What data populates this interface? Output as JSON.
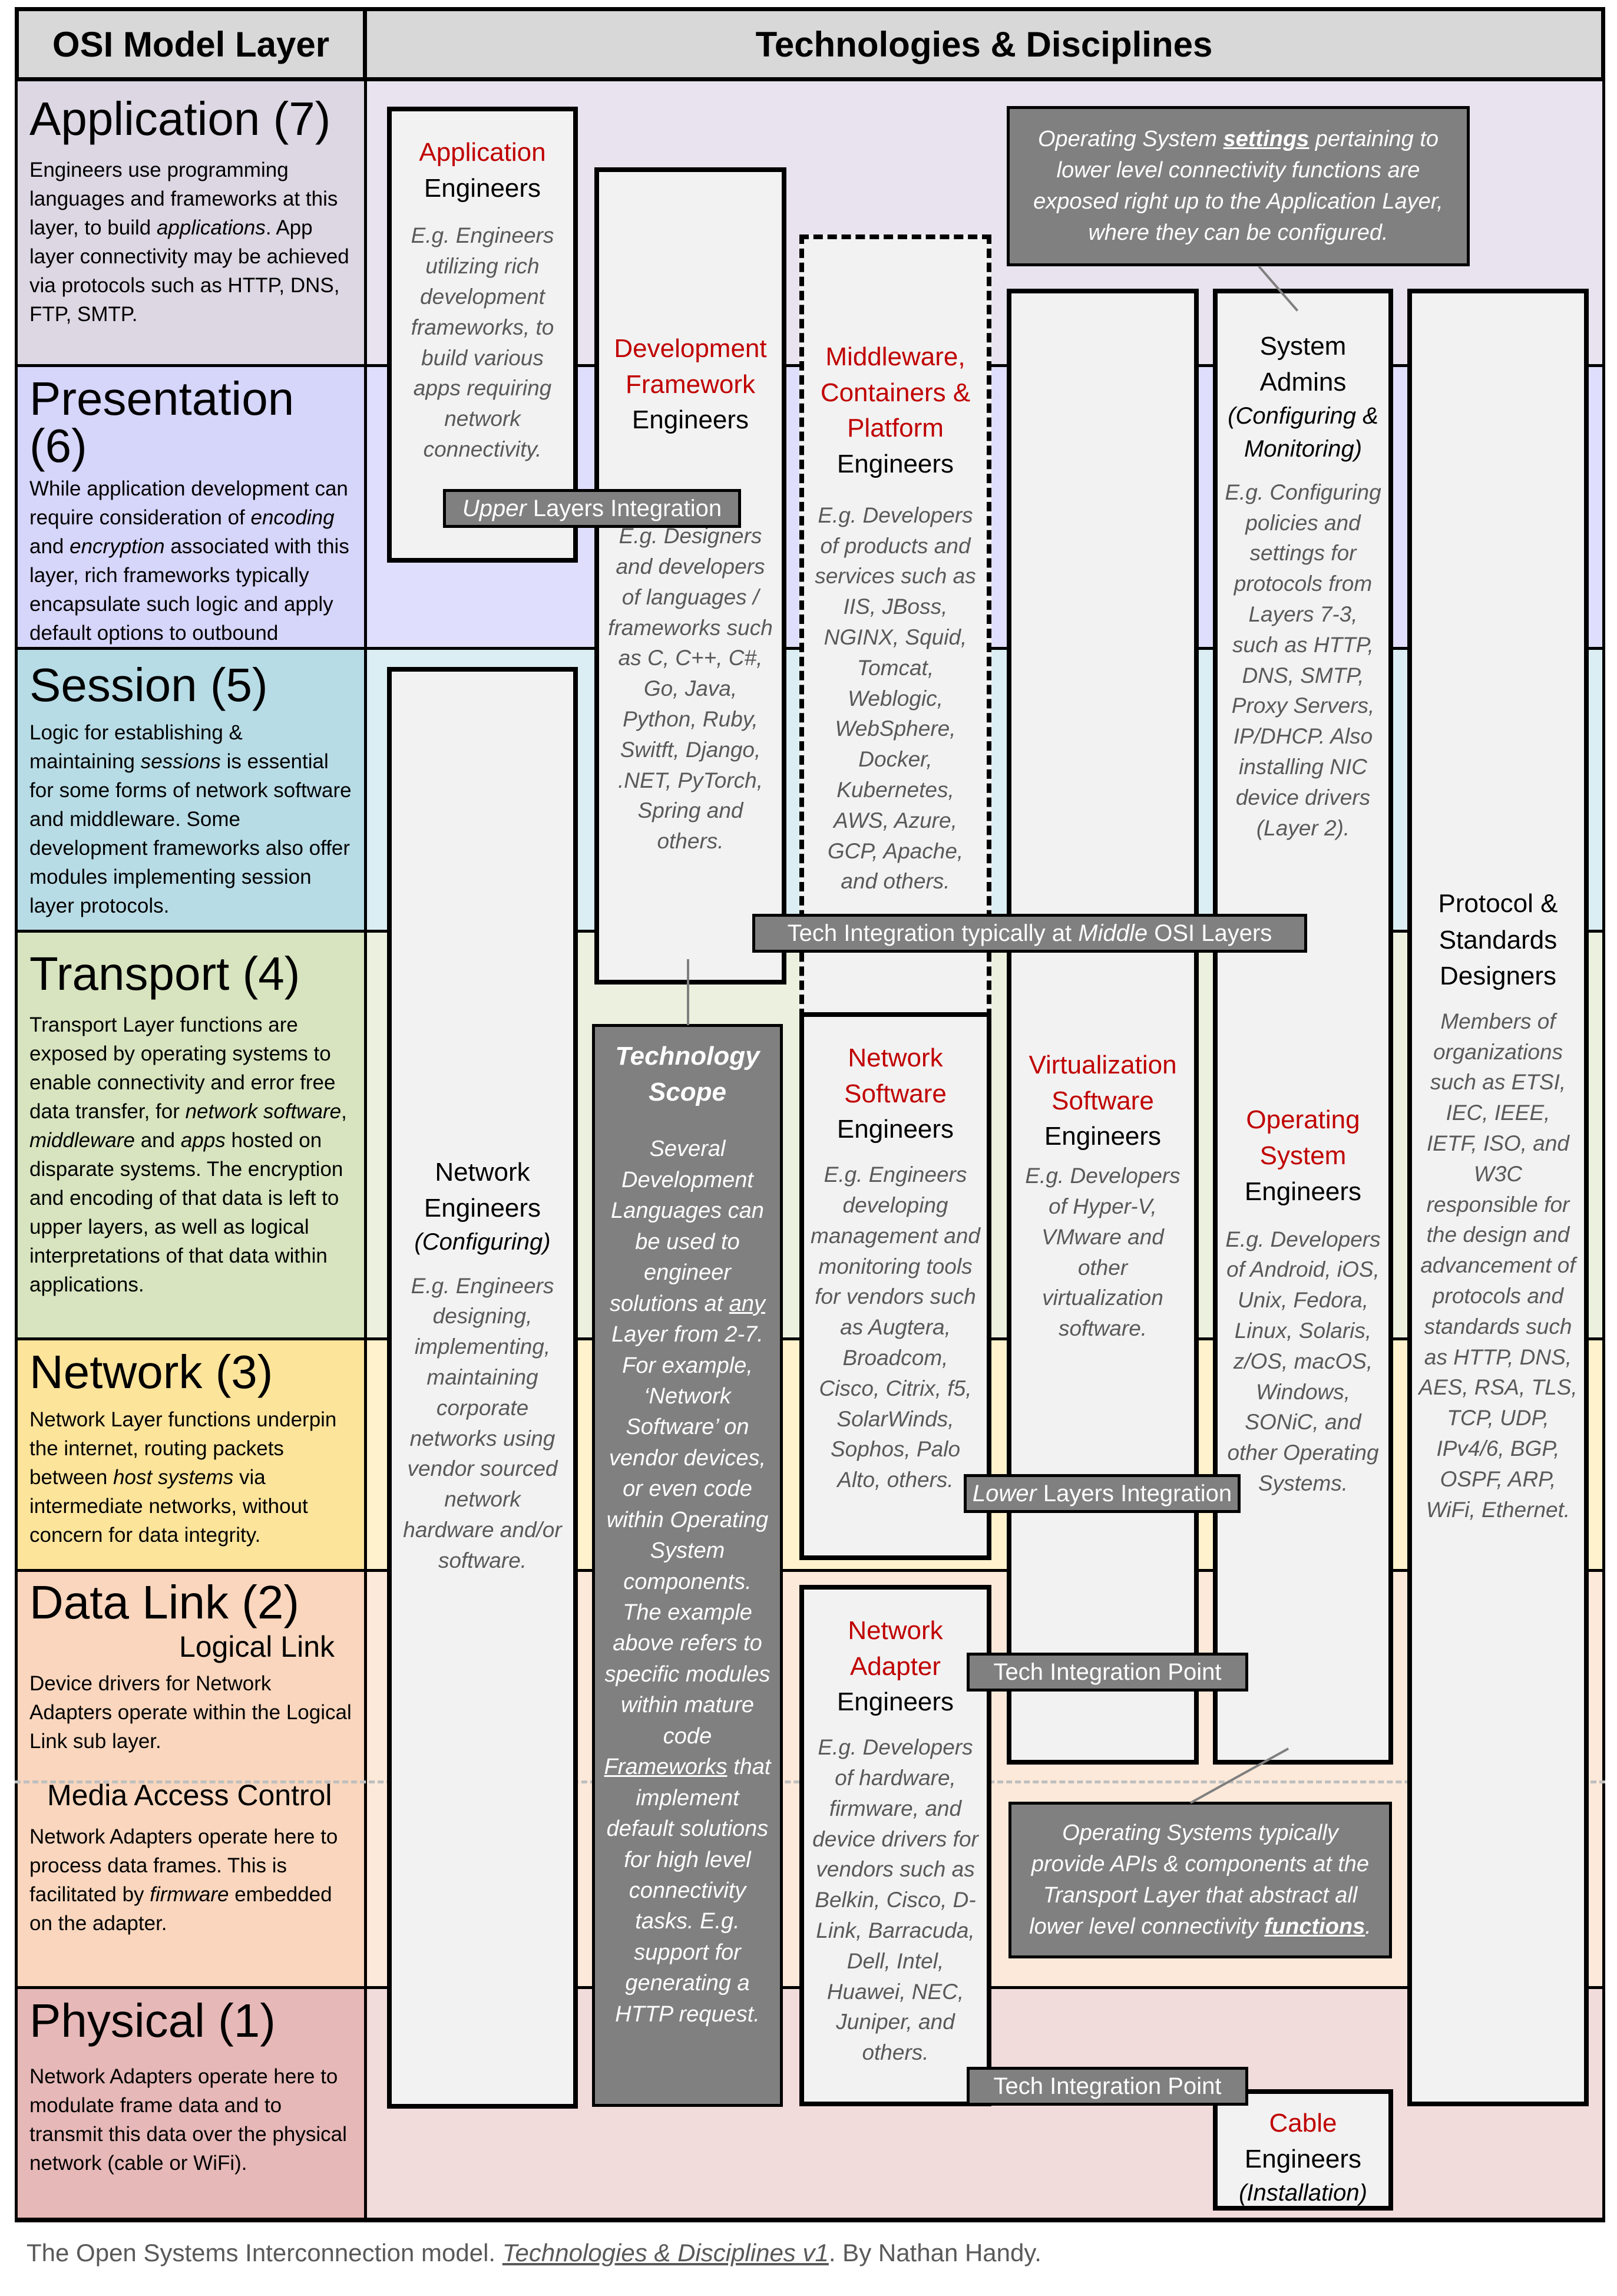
{
  "header": {
    "left_title": "OSI Model Layer",
    "right_title": "Technologies & Disciplines"
  },
  "layers": [
    {
      "name": "Application (7)",
      "color": "#dcd7e3",
      "band_color": "#e8e3ee",
      "description_parts": [
        "Engineers use programming languages and frameworks at this layer, to build ",
        "applications",
        ". App layer connectivity may be achieved via protocols such as HTTP, DNS, FTP, SMTP."
      ]
    },
    {
      "name": "Presentation (6)",
      "color": "#d6d5fa",
      "band_color": "#dfdffd",
      "description_parts": [
        "While application development can require consideration of ",
        "encoding",
        " and ",
        "encryption",
        " associated with this layer, rich frameworks typically encapsulate such logic and apply default options to outbound requests."
      ]
    },
    {
      "name": "Session (5)",
      "color": "#b8dce6",
      "band_color": "#dbeef3",
      "description_parts": [
        "Logic for establishing & maintaining ",
        "sessions",
        " is essential for some forms of network software and middleware. Some development frameworks also offer modules implementing session layer protocols."
      ]
    },
    {
      "name": "Transport (4)",
      "color": "#d7e4bf",
      "band_color": "#ebf1de",
      "description_parts": [
        "Transport Layer functions are exposed by operating systems to enable connectivity and error free data transfer, for ",
        "network software",
        ", ",
        "middleware",
        " and ",
        "apps",
        " hosted on disparate systems. The encryption and encoding of that data is left to upper layers, as well as logical interpretations of that data within applications."
      ]
    },
    {
      "name": "Network (3)",
      "color": "#fde49b",
      "band_color": "#fff2cc",
      "description_parts": [
        "Network Layer functions underpin the internet, routing packets between ",
        "host systems",
        " via intermediate networks, without concern for data integrity."
      ]
    },
    {
      "name": "Data Link (2)",
      "color": "#f9d6bd",
      "band_color": "#fde9d9",
      "sublayers": [
        {
          "name": "Logical Link",
          "description": "Device drivers for Network Adapters operate within the Logical Link sub layer."
        },
        {
          "name": "Media Access Control",
          "description_parts": [
            "Network Adapters operate here to process data frames. This is facilitated by ",
            "firmware",
            " embedded on the adapter."
          ]
        }
      ]
    },
    {
      "name": "Physical (1)",
      "color": "#e6b8b7",
      "band_color": "#f2dcdb",
      "description": "Network Adapters operate here to modulate frame data and to transmit this data over the physical network (cable or WiFi)."
    }
  ],
  "roles": {
    "application": {
      "title_red": "Application",
      "title_black": "Engineers",
      "example": "E.g. Engineers utilizing rich development frameworks, to build various apps requiring network connectivity."
    },
    "dev_framework": {
      "title_red": "Development Framework",
      "title_black": "Engineers",
      "example": "E.g. Designers and developers of languages / frameworks such as C, C++, C#, Go, Java, Python, Ruby, Switft, Django, .NET, PyTorch, Spring and others."
    },
    "middleware": {
      "title_red": "Middleware, Containers & Platform",
      "title_black": "Engineers",
      "example": "E.g. Developers of products and services such as IIS, JBoss, NGINX, Squid, Tomcat, Weblogic, WebSphere, Docker, Kubernetes, AWS, Azure, GCP, Apache, and others."
    },
    "system_admins": {
      "title_black": "System Admins",
      "paren": "(Configuring & Monitoring)",
      "example": "E.g. Configuring policies and settings for protocols from Layers 7-3, such as HTTP, DNS, SMTP, Proxy Servers, IP/DHCP. Also installing NIC device drivers (Layer 2)."
    },
    "protocol_designers": {
      "title_black": "Protocol & Standards Designers",
      "example": "Members of organizations such as ETSI, IEC, IEEE, IETF, ISO, and W3C responsible for the design and advancement of protocols and standards such as HTTP, DNS, AES, RSA, TLS, TCP, UDP, IPv4/6, BGP, OSPF, ARP, WiFi, Ethernet."
    },
    "network_engineers": {
      "title_black": "Network Engineers",
      "paren": "(Configuring)",
      "example": "E.g. Engineers designing, implementing, maintaining corporate networks using vendor sourced network hardware and/or software."
    },
    "network_software": {
      "title_red": "Network Software",
      "title_black": "Engineers",
      "example": "E.g. Engineers developing management and monitoring tools for vendors such as Augtera, Broadcom, Cisco, Citrix, f5, SolarWinds, Sophos, Palo Alto, others."
    },
    "virtualization": {
      "title_red": "Virtualization Software",
      "title_black": "Engineers",
      "example": "E.g. Developers of Hyper-V, VMware and other virtualization software."
    },
    "operating_system": {
      "title_red": "Operating System",
      "title_black": "Engineers",
      "example": "E.g. Developers of Android, iOS, Unix, Fedora, Linux, Solaris, z/OS, macOS, Windows, SONiC, and other Operating Systems."
    },
    "network_adapter": {
      "title_red": "Network Adapter",
      "title_black": "Engineers",
      "example": "E.g. Developers of hardware, firmware, and device drivers for vendors such as Belkin, Cisco, D-Link, Barracuda, Dell, Intel, Huawei, NEC, Juniper, and others."
    },
    "cable": {
      "title_red": "Cable",
      "title_black": "Engineers",
      "paren": "(Installation)"
    }
  },
  "technology_scope": {
    "title": "Technology Scope",
    "body_parts": [
      "Several Development Languages can be used to engineer solutions at ",
      "any",
      " Layer from 2-7. For example, ‘Network Software’ on vendor devices, or even code within Operating System components. The example above refers to specific modules within mature code ",
      "Frameworks",
      " that implement default solutions for high level connectivity tasks. E.g. support for generating a HTTP request."
    ]
  },
  "tags": {
    "upper": {
      "em": "Upper",
      "rest": " Layers Integration"
    },
    "middle": {
      "pre": "Tech Integration typically at ",
      "em": "Middle",
      "post": " OSI Layers"
    },
    "lower": {
      "em": "Lower",
      "rest": " Layers Integration"
    },
    "point1": "Tech Integration Point",
    "point2": "Tech Integration Point"
  },
  "callouts": {
    "os_settings": {
      "pre": "Operating System ",
      "strong": "settings",
      "post": " pertaining to lower level connectivity functions are exposed right up to the Application Layer, where they can be configured."
    },
    "os_apis": {
      "pre": "Operating Systems typically provide APIs & components at the Transport Layer that abstract all lower level connectivity ",
      "strong": "functions",
      "post": "."
    }
  },
  "footer": {
    "pre": "The Open Systems Interconnection model. ",
    "link": "Technologies & Disciplines v1",
    "post": ". By Nathan Handy."
  }
}
